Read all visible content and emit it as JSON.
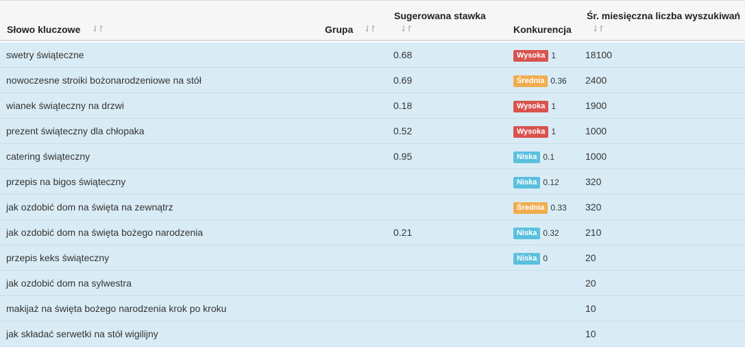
{
  "headers": {
    "keyword": "Słowo kluczowe",
    "group": "Grupa",
    "bid": "Sugerowana stawka",
    "competition": "Konkurencja",
    "volume": "Śr. miesięczna liczba wyszukiwań",
    "sort_icon": "⇃↾"
  },
  "colors": {
    "high": "#d9534f",
    "medium": "#f0ad4e",
    "low": "#5bc0de",
    "row_bg": "#d9ecf5"
  },
  "rows": [
    {
      "keyword": "swetry świąteczne",
      "bid": "0.68",
      "comp_label": "Wysoka",
      "comp_level": "high",
      "comp_value": "1",
      "volume": "18100"
    },
    {
      "keyword": "nowoczesne stroiki bożonarodzeniowe na stół",
      "bid": "0.69",
      "comp_label": "Średnia",
      "comp_level": "mid",
      "comp_value": "0.36",
      "volume": "2400"
    },
    {
      "keyword": "wianek świąteczny na drzwi",
      "bid": "0.18",
      "comp_label": "Wysoka",
      "comp_level": "high",
      "comp_value": "1",
      "volume": "1900"
    },
    {
      "keyword": "prezent świąteczny dla chłopaka",
      "bid": "0.52",
      "comp_label": "Wysoka",
      "comp_level": "high",
      "comp_value": "1",
      "volume": "1000"
    },
    {
      "keyword": "catering świąteczny",
      "bid": "0.95",
      "comp_label": "Niska",
      "comp_level": "low",
      "comp_value": "0.1",
      "volume": "1000"
    },
    {
      "keyword": "przepis na bigos świąteczny",
      "bid": "",
      "comp_label": "Niska",
      "comp_level": "low",
      "comp_value": "0.12",
      "volume": "320"
    },
    {
      "keyword": "jak ozdobić dom na święta na zewnątrz",
      "bid": "",
      "comp_label": "Średnia",
      "comp_level": "mid",
      "comp_value": "0.33",
      "volume": "320"
    },
    {
      "keyword": "jak ozdobić dom na święta bożego narodzenia",
      "bid": "0.21",
      "comp_label": "Niska",
      "comp_level": "low",
      "comp_value": "0.32",
      "volume": "210"
    },
    {
      "keyword": "przepis keks świąteczny",
      "bid": "",
      "comp_label": "Niska",
      "comp_level": "low",
      "comp_value": "0",
      "volume": "20"
    },
    {
      "keyword": "jak ozdobić dom na sylwestra",
      "bid": "",
      "comp_label": "",
      "comp_level": "",
      "comp_value": "",
      "volume": "20"
    },
    {
      "keyword": "makijaż na święta bożego narodzenia krok po kroku",
      "bid": "",
      "comp_label": "",
      "comp_level": "",
      "comp_value": "",
      "volume": "10"
    },
    {
      "keyword": "jak składać serwetki na stół wigilijny",
      "bid": "",
      "comp_label": "",
      "comp_level": "",
      "comp_value": "",
      "volume": "10"
    }
  ]
}
